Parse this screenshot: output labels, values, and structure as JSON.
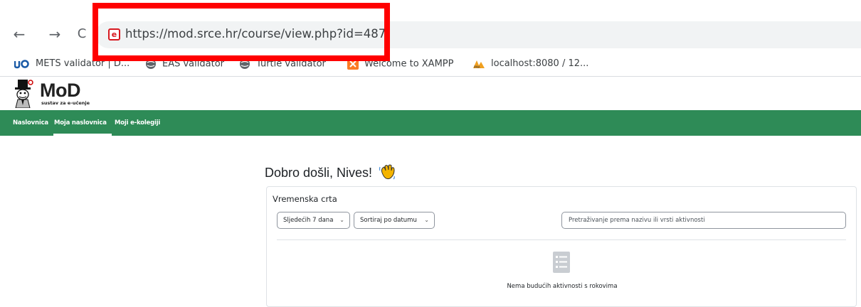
{
  "browser": {
    "back_label": "←",
    "forward_label": "→",
    "reload_label": "C",
    "url": "https://mod.srce.hr/course/view.php?id=487",
    "site_icon_letter": "e"
  },
  "bookmarks": [
    {
      "label": "METS validator | D...",
      "icon": "mets-icon"
    },
    {
      "label": "EAS validator",
      "icon": "globe-icon"
    },
    {
      "label": "Turtle validator",
      "icon": "globe-icon"
    },
    {
      "label": "Welcome to XAMPP",
      "icon": "xampp-icon"
    },
    {
      "label": "localhost:8080 / 12...",
      "icon": "phpmyadmin-icon"
    }
  ],
  "site": {
    "logo_title": "MoD",
    "logo_subtitle": "sustav za e-učenje",
    "nav": [
      {
        "label": "Naslovnica",
        "active": false
      },
      {
        "label": "Moja naslovnica",
        "active": true
      },
      {
        "label": "Moji e-kolegiji",
        "active": false
      }
    ]
  },
  "main": {
    "welcome": "Dobro došli, Nives!",
    "timeline": {
      "title": "Vremenska crta",
      "range_select": "Sljedećih 7 dana",
      "sort_select": "Sortiraj po datumu",
      "search_placeholder": "Pretraživanje prema nazivu ili vrsti aktivnosti",
      "empty_message": "Nema budućih aktivnosti s rokovima"
    }
  },
  "colors": {
    "navbar": "#2e8b57",
    "highlight": "#ff0000",
    "omnibox": "#f1f3f4"
  }
}
